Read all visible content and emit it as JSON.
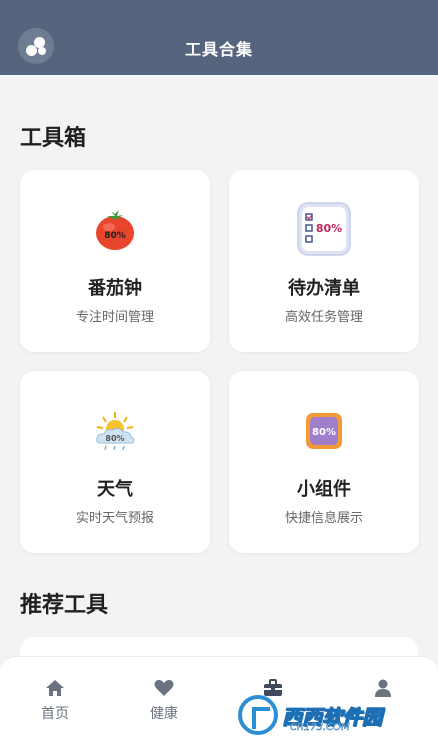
{
  "header": {
    "title": "工具合集",
    "avatar_icon": "bubbles-icon",
    "color": "#56657d"
  },
  "toolbox": {
    "title": "工具箱",
    "cards": [
      {
        "title": "番茄钟",
        "subtitle": "专注时间管理",
        "icon": "tomato-icon",
        "icon_text": "80%"
      },
      {
        "title": "待办清单",
        "subtitle": "高效任务管理",
        "icon": "checklist-icon",
        "icon_text": "80%"
      },
      {
        "title": "天气",
        "subtitle": "实时天气预报",
        "icon": "weather-icon",
        "icon_text": "80%"
      },
      {
        "title": "小组件",
        "subtitle": "快捷信息展示",
        "icon": "widget-icon",
        "icon_text": "80%"
      }
    ]
  },
  "recommended": {
    "title": "推荐工具"
  },
  "nav": {
    "items": [
      {
        "label": "首页",
        "icon": "home-icon"
      },
      {
        "label": "健康",
        "icon": "heart-icon"
      },
      {
        "label": "",
        "icon": "toolbox-icon"
      },
      {
        "label": "",
        "icon": "user-icon"
      }
    ]
  },
  "watermark": {
    "text": "西西软件园",
    "sub": "CR173.COM"
  }
}
